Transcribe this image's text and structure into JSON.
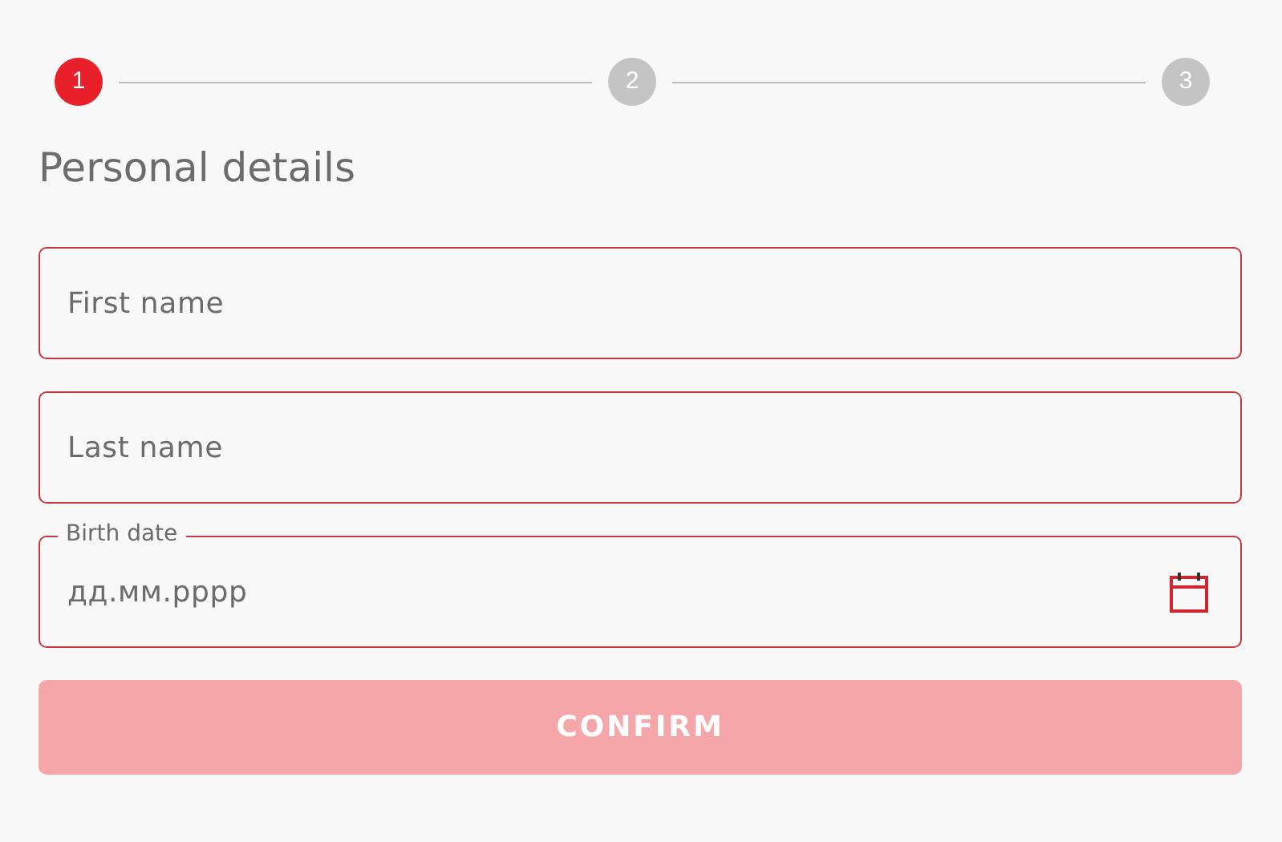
{
  "steps": [
    {
      "label": "1",
      "selected": true
    },
    {
      "label": "2",
      "selected": false
    },
    {
      "label": "3",
      "selected": false
    }
  ],
  "title": "Personal details",
  "fields": [
    {
      "kind": "text",
      "placeholder": "First name"
    },
    {
      "kind": "text",
      "placeholder": "Last name"
    },
    {
      "kind": "date",
      "label": "Birth date",
      "placeholder": "дд.мм.рррр"
    }
  ],
  "button": {
    "label": "CONFIRM",
    "disabled": true
  }
}
